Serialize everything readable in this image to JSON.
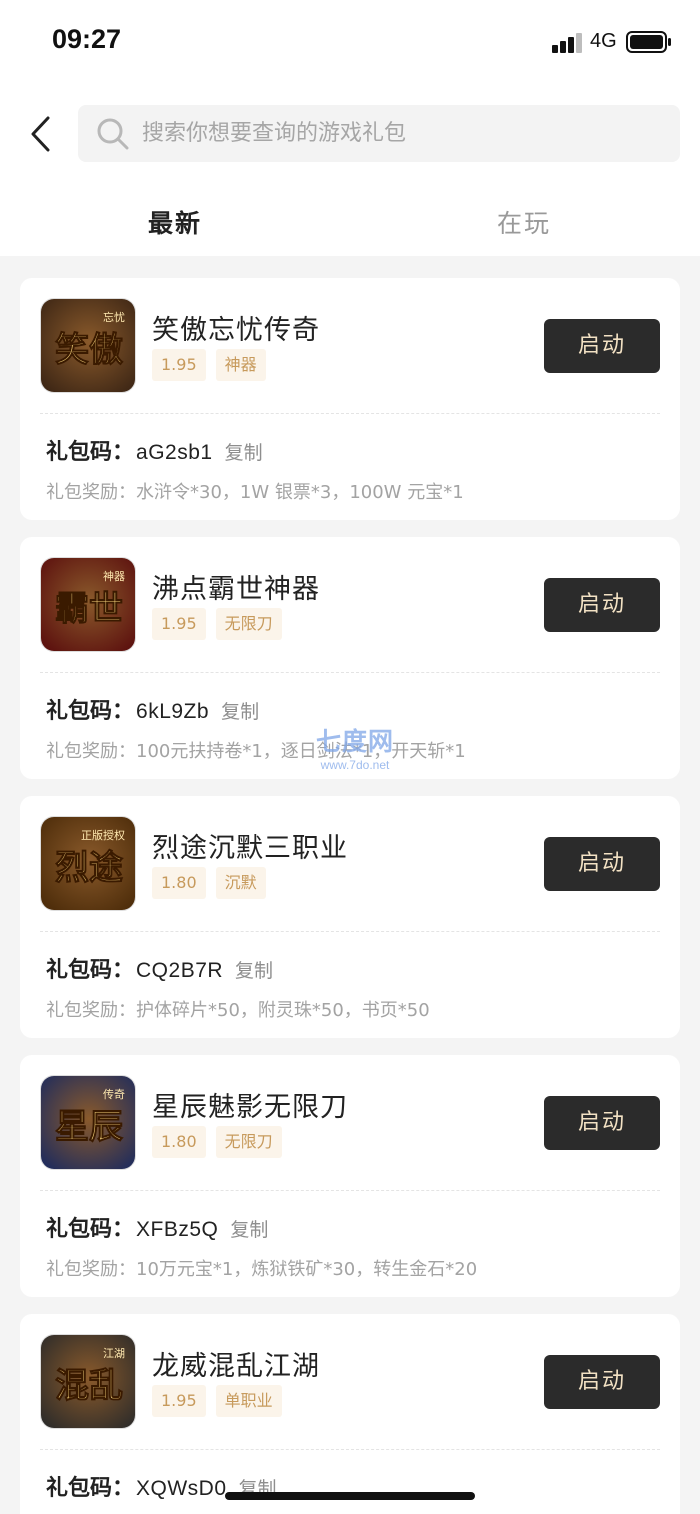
{
  "status_bar": {
    "time": "09:27",
    "network": "4G"
  },
  "search": {
    "placeholder": "搜索你想要查询的游戏礼包"
  },
  "tabs": [
    {
      "label": "最新",
      "active": true
    },
    {
      "label": "在玩",
      "active": false
    }
  ],
  "labels": {
    "code_label": "礼包码：",
    "reward_prefix": "礼包奖励：",
    "copy": "复制",
    "launch": "启动"
  },
  "games": [
    {
      "name": "笑傲忘忧传奇",
      "tags": [
        "1.95",
        "神器"
      ],
      "code": "aG2sb1",
      "rewards": "水浒令*30，1W 银票*3，100W 元宝*1",
      "icon_text": "笑傲",
      "icon_sub": "忘忧",
      "icon_bg": "#3a2414"
    },
    {
      "name": "沸点霸世神器",
      "tags": [
        "1.95",
        "无限刀"
      ],
      "code": "6kL9Zb",
      "rewards": "100元扶持卷*1，逐日剑法*1，开天斩*1",
      "icon_text": "霸世",
      "icon_sub": "神器",
      "icon_bg": "#5a0d0d"
    },
    {
      "name": "烈途沉默三职业",
      "tags": [
        "1.80",
        "沉默"
      ],
      "code": "CQ2B7R",
      "rewards": "护体碎片*50，附灵珠*50，书页*50",
      "icon_text": "烈途",
      "icon_sub": "正版授权",
      "icon_bg": "#4a2a08"
    },
    {
      "name": "星辰魅影无限刀",
      "tags": [
        "1.80",
        "无限刀"
      ],
      "code": "XFBz5Q",
      "rewards": "10万元宝*1，炼狱铁矿*30，转生金石*20",
      "icon_text": "星辰",
      "icon_sub": "传奇",
      "icon_bg": "#1b2a5e"
    },
    {
      "name": "龙威混乱江湖",
      "tags": [
        "1.95",
        "单职业"
      ],
      "code": "XQWsD0",
      "rewards": "",
      "icon_text": "混乱",
      "icon_sub": "江湖",
      "icon_bg": "#2a2a2a"
    }
  ],
  "watermark": {
    "main": "七度网",
    "url": "www.7do.net"
  }
}
